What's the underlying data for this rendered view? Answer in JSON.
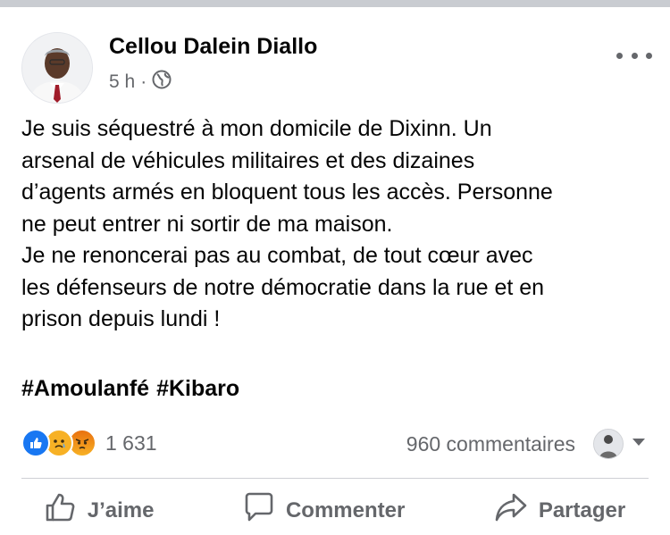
{
  "post": {
    "author": "Cellou Dalein Diallo",
    "time": "5 h",
    "separator": "·",
    "visibility_icon": "globe-icon",
    "lines": [
      "Je suis séquestré à mon domicile de Dixinn. Un",
      "arsenal de véhicules militaires et des dizaines",
      "d’agents armés en bloquent tous les accès. Personne",
      "ne peut entrer ni sortir de ma maison.",
      "Je ne renoncerai pas au combat, de tout cœur avec",
      "les défenseurs de notre démocratie dans la rue et en",
      "prison depuis lundi !"
    ],
    "hashtags": [
      "#Amoulanfé",
      "#Kibaro"
    ]
  },
  "engagement": {
    "reaction_icons": [
      "like-icon",
      "sad-icon",
      "angry-icon"
    ],
    "reaction_count": "1 631",
    "comments_count": "960 commentaires"
  },
  "actions": {
    "like_label": "J’aime",
    "comment_label": "Commenter",
    "share_label": "Partager"
  },
  "colors": {
    "like_blue": "#1877f2",
    "sad_yellow": "#f7b125",
    "angry_orange": "#e9710f",
    "secondary_text": "#65676b",
    "divider": "#ced0d4"
  }
}
